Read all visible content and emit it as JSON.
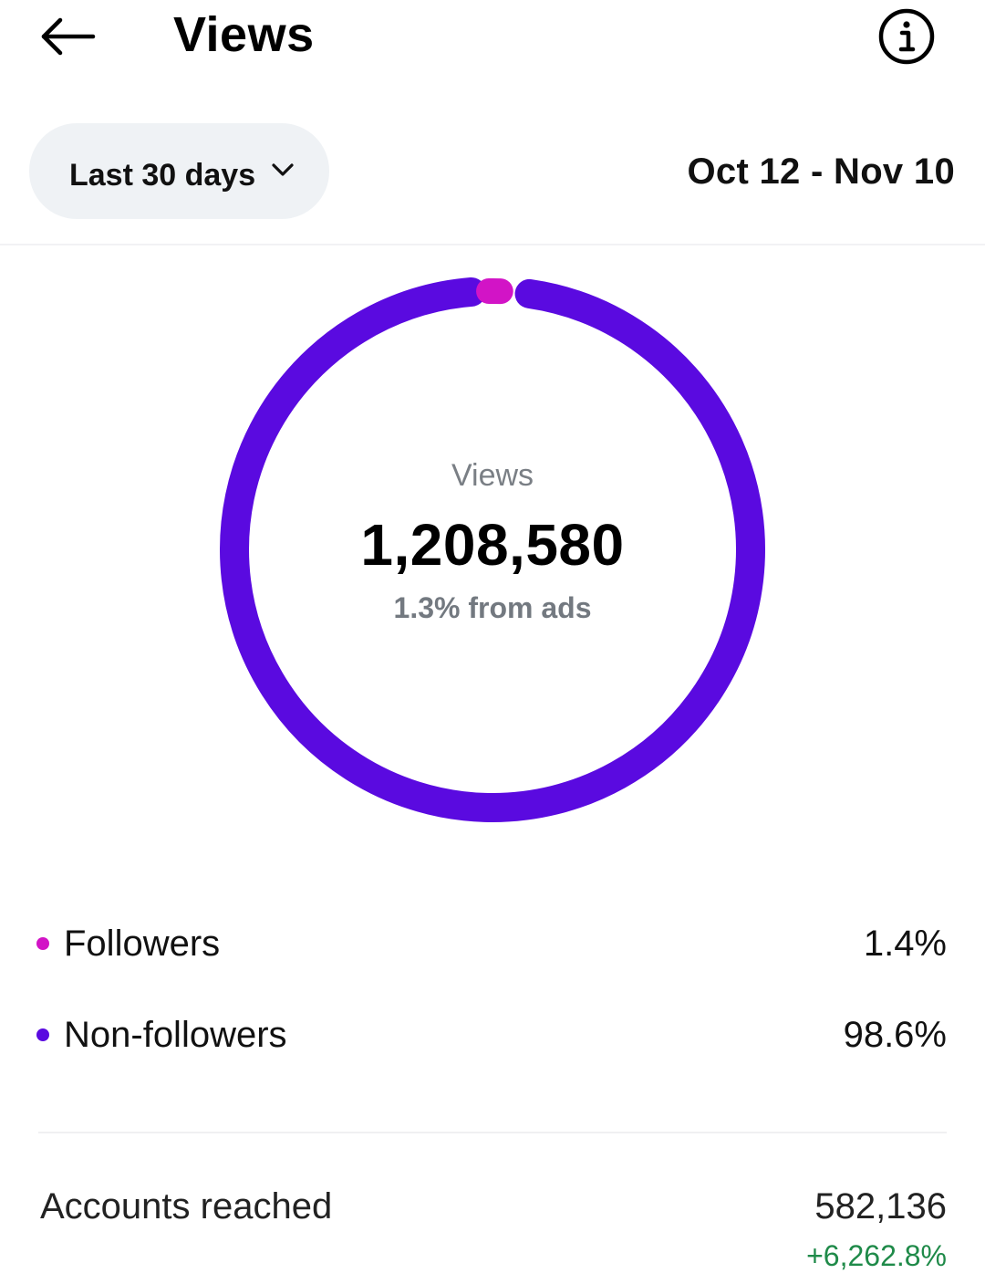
{
  "header": {
    "title": "Views",
    "back_icon": "arrow-left-icon",
    "info_icon": "info-icon"
  },
  "filter": {
    "range_label": "Last 30 days",
    "range_icon": "chevron-down-icon",
    "date_range": "Oct 12 - Nov 10"
  },
  "summary": {
    "label": "Views",
    "value": "1,208,580",
    "sub": "1.3% from ads"
  },
  "chart_data": {
    "type": "pie",
    "categories": [
      "Followers",
      "Non-followers"
    ],
    "values": [
      1.4,
      98.6
    ],
    "colors": [
      "#d214c6",
      "#5a0ae0"
    ]
  },
  "legend": [
    {
      "name": "Followers",
      "value": "1.4%",
      "color": "#d214c6"
    },
    {
      "name": "Non-followers",
      "value": "98.6%",
      "color": "#5a0ae0"
    }
  ],
  "accounts_reached": {
    "label": "Accounts reached",
    "value": "582,136",
    "change": "+6,262.8%",
    "change_color": "#1f8a49"
  }
}
